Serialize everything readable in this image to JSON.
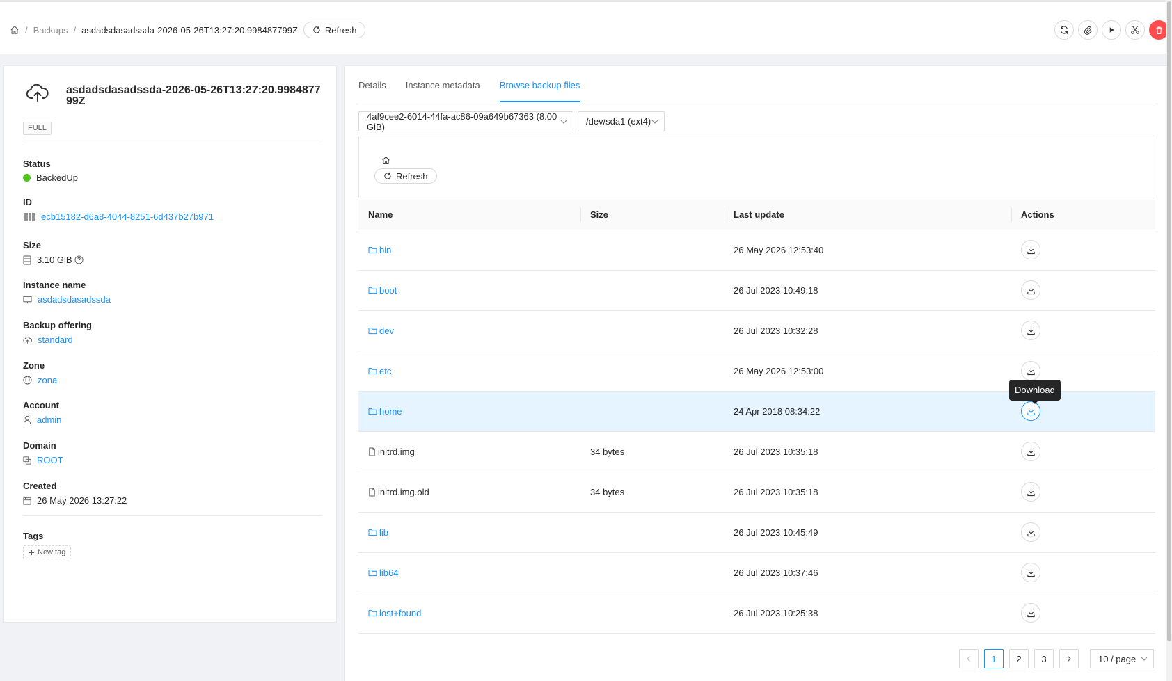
{
  "breadcrumb": {
    "home_icon": "home-icon",
    "parent": "Backups",
    "current": "asdadsdasadssda-2026-05-26T13:27:20.998487799Z",
    "refresh_label": "Refresh"
  },
  "toolbar": {
    "icons": [
      "sync-icon",
      "paperclip-icon",
      "play-icon",
      "scissors-icon",
      "delete-icon"
    ],
    "danger_color": "#ff4d4f"
  },
  "backup": {
    "icon": "cloud-upload-icon",
    "title": "asdadsdasadssda-2026-05-26T13:27:20.998487799Z",
    "type_tag": "FULL",
    "fields": {
      "status": {
        "label": "Status",
        "value": "BackedUp",
        "color": "#52c41a"
      },
      "id": {
        "label": "ID",
        "value": "ecb15182-d6a8-4044-8251-6d437b27b971"
      },
      "size": {
        "label": "Size",
        "value": "3.10 GiB"
      },
      "instance": {
        "label": "Instance name",
        "value": "asdadsdasadssda"
      },
      "offering": {
        "label": "Backup offering",
        "value": "standard"
      },
      "zone": {
        "label": "Zone",
        "value": "zona"
      },
      "account": {
        "label": "Account",
        "value": "admin"
      },
      "domain": {
        "label": "Domain",
        "value": "ROOT"
      },
      "created": {
        "label": "Created",
        "value": "26 May 2026 13:27:22"
      }
    },
    "tags": {
      "label": "Tags",
      "new_tag": "New tag"
    }
  },
  "tabs": [
    {
      "label": "Details"
    },
    {
      "label": "Instance metadata"
    },
    {
      "label": "Browse backup files"
    }
  ],
  "active_tab": "Browse backup files",
  "volume_select": "4af9cee2-6014-44fa-ac86-09a649b67363 (8.00 GiB)",
  "partition_select": "/dev/sda1 (ext4)",
  "path": {
    "refresh_label": "Refresh"
  },
  "table": {
    "columns": [
      "Name",
      "Size",
      "Last update",
      "Actions"
    ],
    "rows": [
      {
        "name": "bin",
        "kind": "folder",
        "size": "",
        "updated": "26 May 2026 12:53:40"
      },
      {
        "name": "boot",
        "kind": "folder",
        "size": "",
        "updated": "26 Jul 2023 10:49:18"
      },
      {
        "name": "dev",
        "kind": "folder",
        "size": "",
        "updated": "26 Jul 2023 10:32:28"
      },
      {
        "name": "etc",
        "kind": "folder",
        "size": "",
        "updated": "26 May 2026 12:53:00"
      },
      {
        "name": "home",
        "kind": "folder",
        "size": "",
        "updated": "24 Apr 2018 08:34:22"
      },
      {
        "name": "initrd.img",
        "kind": "file",
        "size": "34 bytes",
        "updated": "26 Jul 2023 10:35:18"
      },
      {
        "name": "initrd.img.old",
        "kind": "file",
        "size": "34 bytes",
        "updated": "26 Jul 2023 10:35:18"
      },
      {
        "name": "lib",
        "kind": "folder",
        "size": "",
        "updated": "26 Jul 2023 10:45:49"
      },
      {
        "name": "lib64",
        "kind": "folder",
        "size": "",
        "updated": "26 Jul 2023 10:37:46"
      },
      {
        "name": "lost+found",
        "kind": "folder",
        "size": "",
        "updated": "26 Jul 2023 10:25:38"
      }
    ],
    "highlighted_row": "home"
  },
  "tooltip": "Download",
  "pagination": {
    "prev_icon": "chevron-left-icon",
    "next_icon": "chevron-right-icon",
    "pages": [
      "1",
      "2",
      "3"
    ],
    "current": "1",
    "page_size": "10 / page"
  },
  "accent_color": "#1890ff"
}
